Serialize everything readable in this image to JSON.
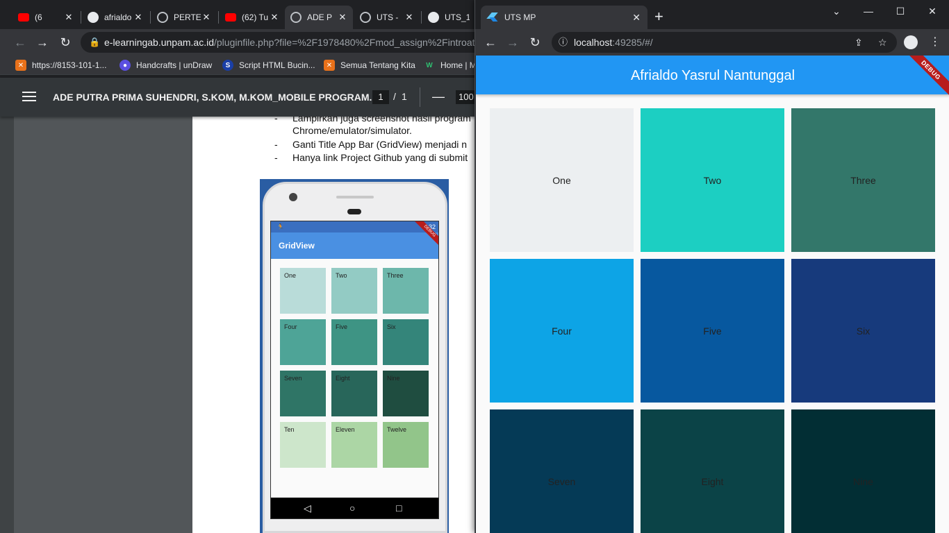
{
  "background_browser": {
    "tabs": [
      {
        "label": "(6",
        "icon": "youtube-icon"
      },
      {
        "label": "afrialdo",
        "icon": "github-icon"
      },
      {
        "label": "PERTE",
        "icon": "globe-icon"
      },
      {
        "label": "(62) Tu",
        "icon": "youtube-icon"
      },
      {
        "label": "ADE P",
        "icon": "globe-icon"
      },
      {
        "label": "UTS -",
        "icon": "globe-icon"
      },
      {
        "label": "UTS_1",
        "icon": "github-icon"
      }
    ],
    "url_host": "e-learningab.unpam.ac.id",
    "url_path": "/pluginfile.php?file=%2F1978480%2Fmod_assign%2Fintroatta",
    "bookmarks": [
      "https://8153-101-1...",
      "Handcrafts | unDraw",
      "Script HTML Bucin...",
      "Semua Tentang Kita",
      "Home | M"
    ]
  },
  "pdf": {
    "title": "ADE PUTRA PRIMA SUHENDRI, S.KOM, M.KOM_MOBILE PROGRAM...",
    "page": "1",
    "page_sep": "/",
    "total_pages": "1",
    "zoom_out": "—",
    "zoom": "100",
    "lines": [
      "-",
      "Lampirkan juga screenshot hasil program",
      "Chrome/emulator/simulator.",
      "-",
      "Ganti Title App Bar (GridView) menjadi n",
      "-",
      "Hanya link Project Github yang di submit"
    ],
    "phone": {
      "time": "5:32",
      "title": "GridView",
      "debug": "DEBUG",
      "cells": [
        {
          "label": "One",
          "color": "#b9dcd9"
        },
        {
          "label": "Two",
          "color": "#93cbc4"
        },
        {
          "label": "Three",
          "color": "#6db7ab"
        },
        {
          "label": "Four",
          "color": "#4ea497"
        },
        {
          "label": "Five",
          "color": "#3e9484"
        },
        {
          "label": "Six",
          "color": "#34857a"
        },
        {
          "label": "Seven",
          "color": "#2f7566"
        },
        {
          "label": "Eight",
          "color": "#28665a"
        },
        {
          "label": "Nine",
          "color": "#1f4d40"
        },
        {
          "label": "Ten",
          "color": "#cde6cb"
        },
        {
          "label": "Eleven",
          "color": "#acd6a5"
        },
        {
          "label": "Twelve",
          "color": "#92c58a"
        }
      ]
    }
  },
  "foreground_browser": {
    "tab_title": "UTS MP",
    "url_host": "localhost",
    "url_rest": ":49285/#/",
    "app": {
      "title": "Afrialdo Yasrul Nantunggal",
      "debug": "DEBUG",
      "cells": [
        {
          "label": "One",
          "color": "#eceff1"
        },
        {
          "label": "Two",
          "color": "#1ccfc2"
        },
        {
          "label": "Three",
          "color": "#33776a"
        },
        {
          "label": "Four",
          "color": "#0da4e6"
        },
        {
          "label": "Five",
          "color": "#07589f"
        },
        {
          "label": "Six",
          "color": "#173a7c"
        },
        {
          "label": "Seven",
          "color": "#053a56"
        },
        {
          "label": "Eight",
          "color": "#0b4347"
        },
        {
          "label": "Nine",
          "color": "#022e34"
        }
      ]
    }
  }
}
